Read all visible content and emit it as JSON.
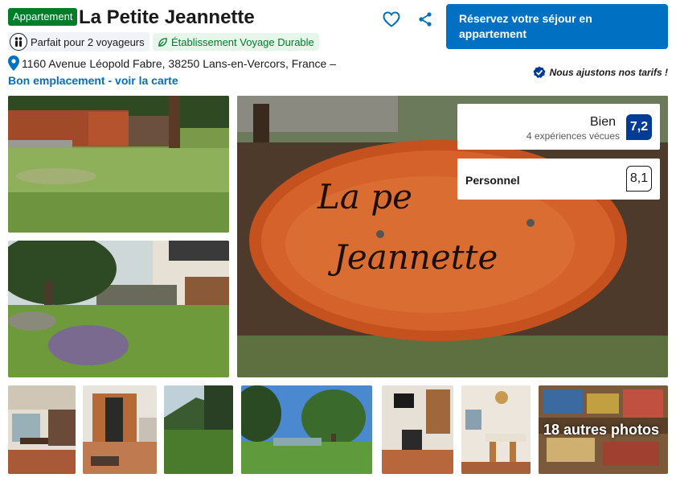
{
  "header": {
    "type_badge": "Appartement",
    "title": "La Petite Jeannette",
    "reserve_label": "Réservez votre séjour en appartement",
    "favorite_icon": "heart-icon",
    "share_icon": "share-icon"
  },
  "tags": {
    "travellers": "Parfait pour 2 voyageurs",
    "sustainable": "Établissement Voyage Durable"
  },
  "location": {
    "address": "1160 Avenue Léopold Fabre, 38250 Lans-en-Vercors, France –",
    "map_link": "Bon emplacement - voir la carte"
  },
  "price_note": "Nous ajustons nos tarifs !",
  "rating": {
    "word": "Bien",
    "experiences": "4 expériences vécues",
    "score": "7,2"
  },
  "staff_rating": {
    "label": "Personnel",
    "score": "8,1"
  },
  "gallery": {
    "sign_text_line1": "La pe",
    "sign_text_line2": "Jeannette",
    "more_photos": "18 autres photos"
  },
  "colors": {
    "brand_blue": "#0071c2",
    "score_navy": "#003b95",
    "green": "#007d2a"
  }
}
